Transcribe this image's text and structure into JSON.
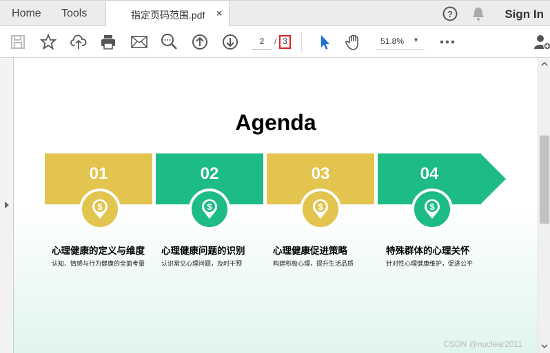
{
  "tabs": {
    "home": "Home",
    "tools": "Tools",
    "document": "指定页码范围.pdf",
    "close": "×"
  },
  "header": {
    "sign_in": "Sign In"
  },
  "toolbar": {
    "current_page": "2",
    "separator": "/",
    "total_pages": "3",
    "zoom": "51.8%"
  },
  "slide": {
    "title": "Agenda",
    "colors": {
      "yellow": "#E2C44E",
      "green": "#1DBB85"
    },
    "items": [
      {
        "num": "01",
        "heading": "心理健康的定义与维度",
        "desc": "认知、情感与行为健康的全面考量"
      },
      {
        "num": "02",
        "heading": "心理健康问题的识别",
        "desc": "认识常见心理问题，及时干预"
      },
      {
        "num": "03",
        "heading": "心理健康促进策略",
        "desc": "构建积极心理，提升生活品质"
      },
      {
        "num": "04",
        "heading": "特殊群体的心理关怀",
        "desc": "针对性心理健康维护，促进公平"
      }
    ]
  },
  "watermark": "CSDN @nuclear2011"
}
